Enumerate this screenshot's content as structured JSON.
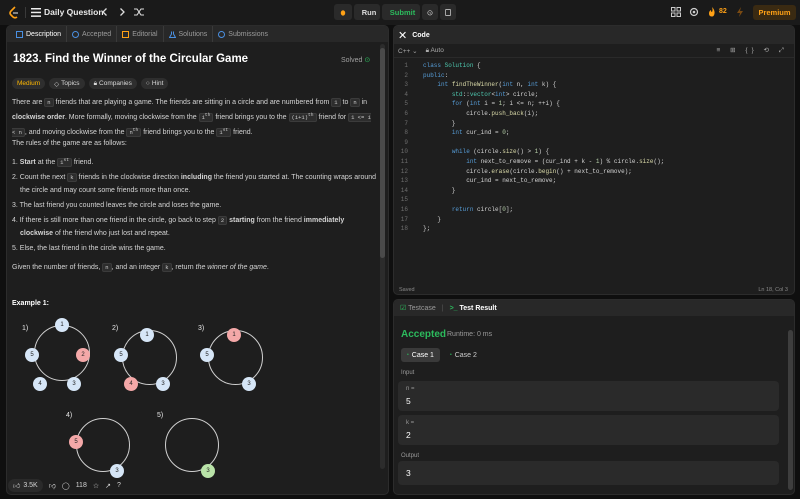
{
  "topbar": {
    "title": "Daily Question",
    "run": "Run",
    "submit": "Submit",
    "streak": "82",
    "premium": "Premium"
  },
  "desc_tabs": [
    "Description",
    "Accepted",
    "Editorial",
    "Solutions",
    "Submissions"
  ],
  "problem": {
    "title": "1823. Find the Winner of the Circular Game",
    "status": "Solved",
    "difficulty": "Medium",
    "chips": [
      "Topics",
      "Companies",
      "Hint"
    ],
    "rules_intro": "The rules of the game are as follows:",
    "example_heading": "Example 1:",
    "likes": "3.5K",
    "comments": "118"
  },
  "editor": {
    "header": "Code",
    "language": "C++",
    "mode": "Auto",
    "saved": "Saved",
    "cursor": "Ln 18, Col 3",
    "lines": [
      "class Solution {",
      "public:",
      "    int findTheWinner(int n, int k) {",
      "        std::vector<int> circle;",
      "        for (int i = 1; i <= n; ++i) {",
      "            circle.push_back(i);",
      "        }",
      "        int cur_ind = 0;",
      "",
      "        while (circle.size() > 1) {",
      "            int next_to_remove = (cur_ind + k - 1) % circle.size();",
      "            circle.erase(circle.begin() + next_to_remove);",
      "            cur_ind = next_to_remove;",
      "        }",
      "",
      "        return circle[0];",
      "    }",
      "};"
    ]
  },
  "result": {
    "tab_testcase": "Testcase",
    "tab_result": "Test Result",
    "status": "Accepted",
    "runtime": "Runtime: 0 ms",
    "case1": "Case 1",
    "case2": "Case 2",
    "input_label": "Input",
    "n_label": "n =",
    "n_value": "5",
    "k_label": "k =",
    "k_value": "2",
    "output_label": "Output",
    "output_value": "3"
  },
  "diagram": {
    "labels": [
      "1)",
      "2)",
      "3)",
      "4)",
      "5)"
    ]
  },
  "colors": {
    "accent": "#ffa116",
    "accepted": "#2cbb5d",
    "medium": "#ffb800"
  }
}
